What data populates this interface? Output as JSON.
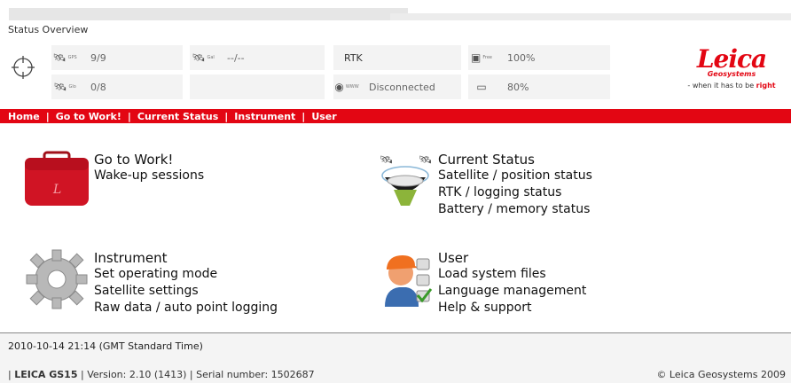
{
  "header": {
    "title": "Status Overview"
  },
  "status": {
    "gps": {
      "label": "GPS",
      "value": "9/9"
    },
    "glo": {
      "label": "Glo",
      "value": "0/8"
    },
    "gal": {
      "label": "Gal",
      "value": "--/--"
    },
    "rtk": {
      "label": "RTK"
    },
    "www": {
      "label": "WWW",
      "value": "Disconnected"
    },
    "free": {
      "label": "Free",
      "value": "100%"
    },
    "battery": {
      "value": "80%"
    }
  },
  "logo": {
    "brand": "Leica",
    "sub": "Geosystems",
    "tagline": "- when it has to be ",
    "tagline_accent": "right"
  },
  "nav": {
    "items": [
      "Home",
      "Go to Work!",
      "Current Status",
      "Instrument",
      "User"
    ],
    "separator": "|"
  },
  "tiles": {
    "work": {
      "title": "Go to Work!",
      "lines": [
        "Wake-up sessions"
      ]
    },
    "status": {
      "title": "Current Status",
      "lines": [
        "Satellite / position status",
        "RTK / logging status",
        "Battery / memory status"
      ]
    },
    "instrument": {
      "title": "Instrument",
      "lines": [
        "Set operating mode",
        "Satellite settings",
        "Raw data / auto point logging"
      ]
    },
    "user": {
      "title": "User",
      "lines": [
        "Load system files",
        "Language management",
        "Help & support"
      ]
    }
  },
  "footer": {
    "timestamp": "2010-10-14 21:14 (GMT Standard Time)",
    "device_pre": "| ",
    "device": "LEICA GS15",
    "device_rest": " | Version: 2.10 (1413) | Serial number: 1502687",
    "copyright": "© Leica Geosystems 2009"
  },
  "colors": {
    "accent": "#e30613"
  }
}
